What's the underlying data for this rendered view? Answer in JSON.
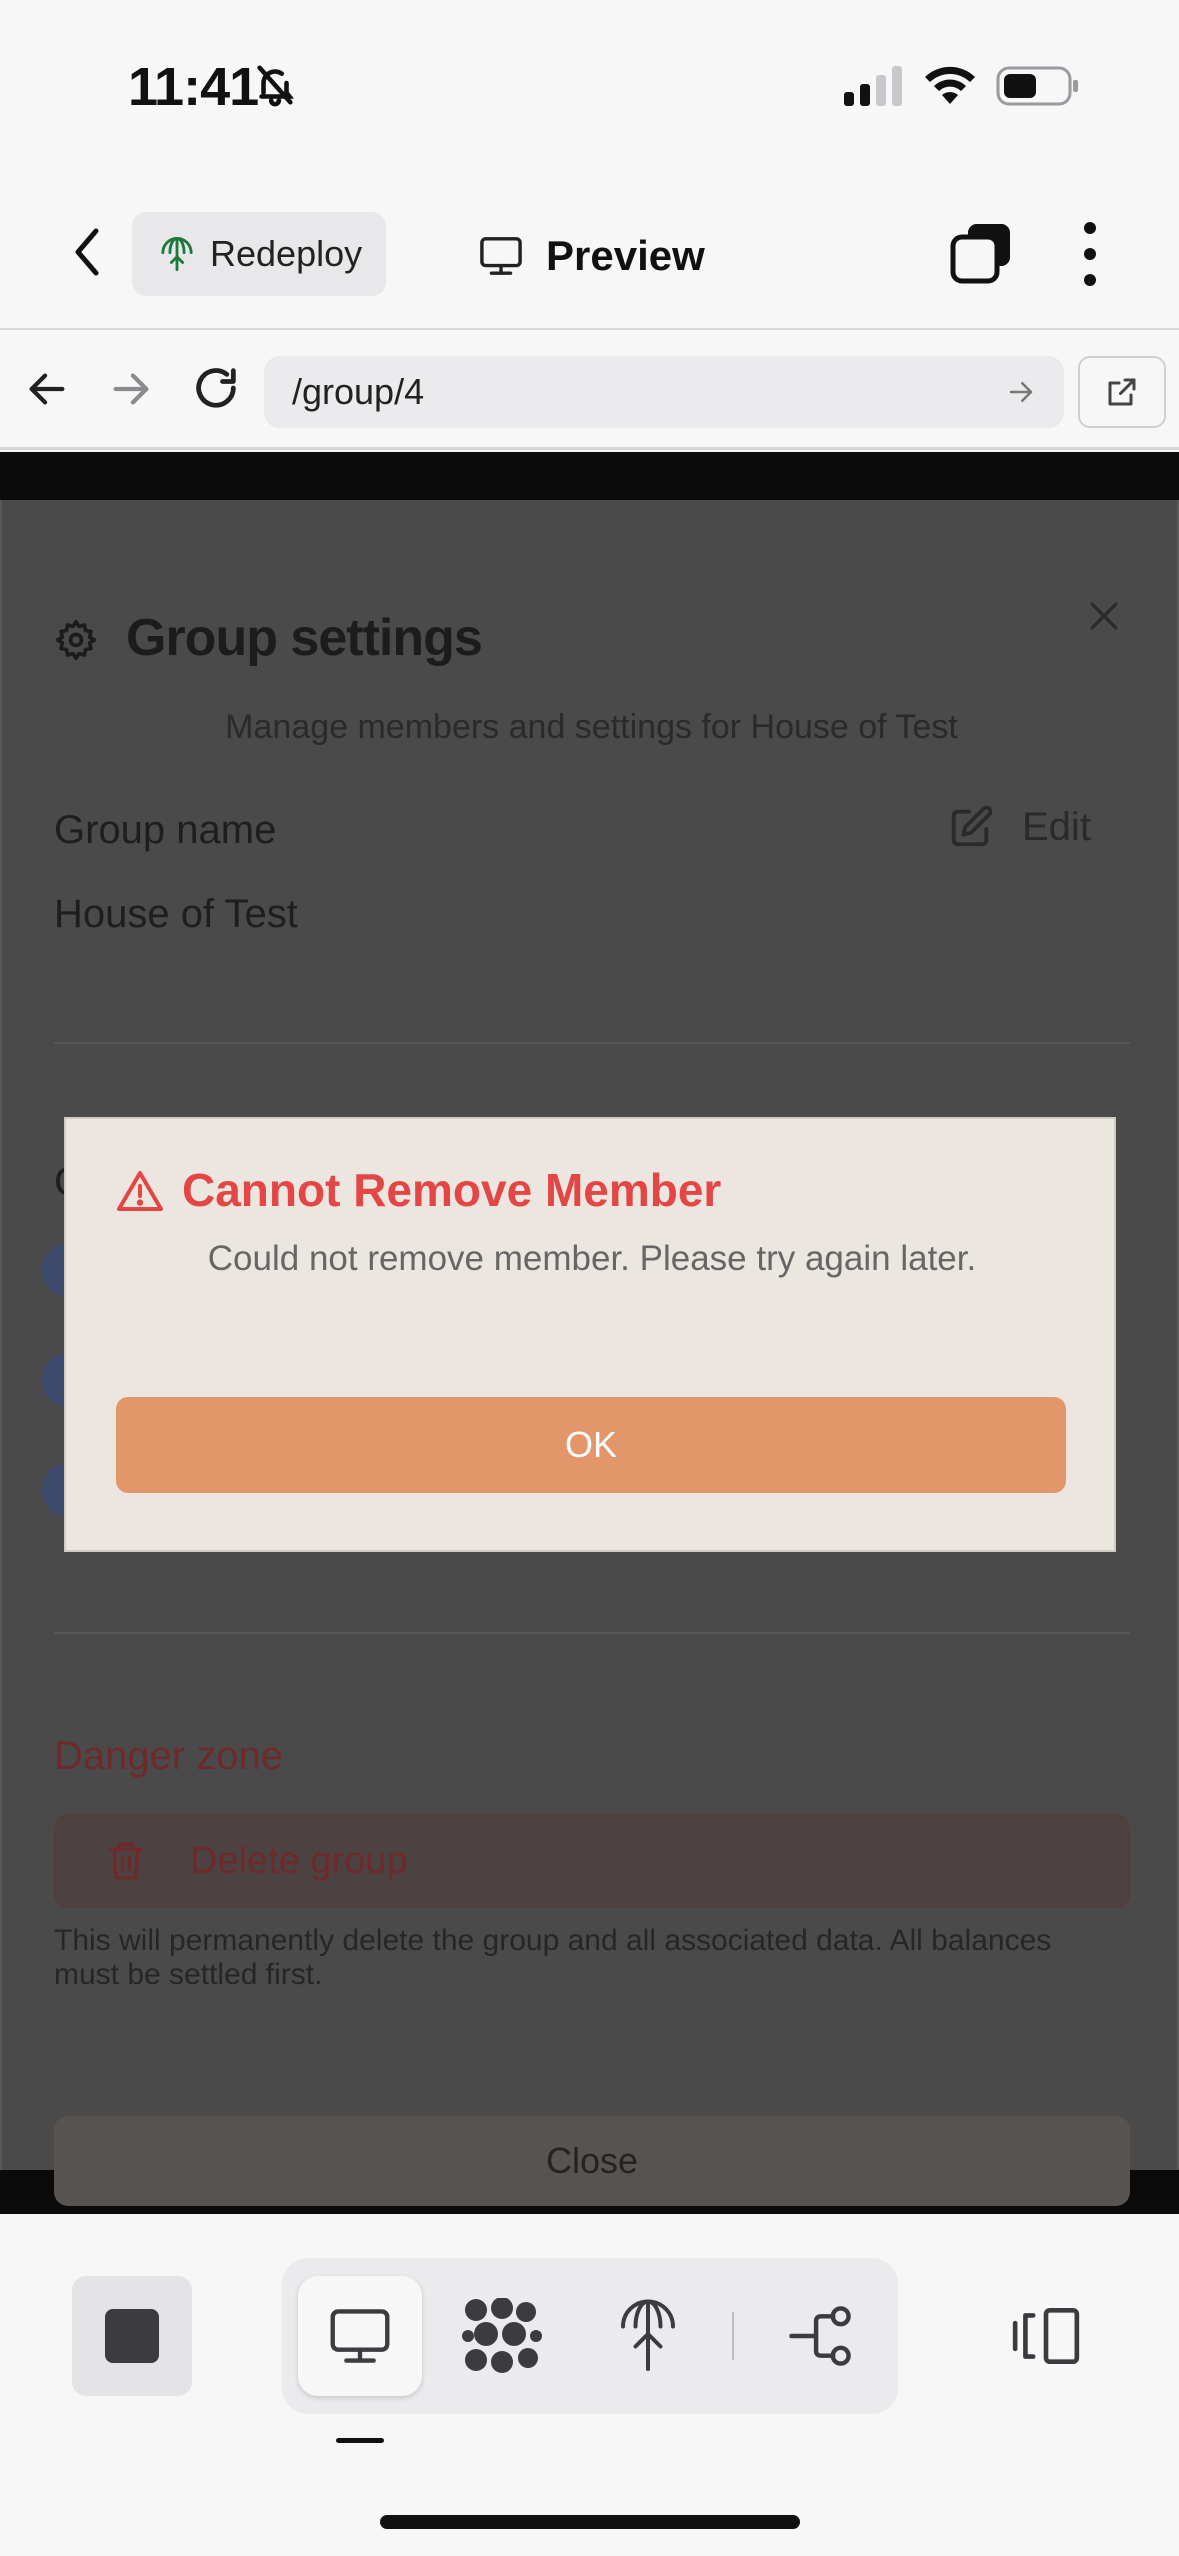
{
  "status_bar": {
    "time": "11:41",
    "silent_icon": "bell-slash-icon",
    "signal_icon": "cellular-signal-icon",
    "wifi_icon": "wifi-icon",
    "battery_icon": "battery-icon"
  },
  "header": {
    "redeploy_label": "Redeploy",
    "preview_label": "Preview"
  },
  "browser": {
    "url": "/group/4"
  },
  "group_settings": {
    "title": "Group settings",
    "subtitle": "Manage members and settings for House of Test",
    "group_name_label": "Group name",
    "edit_label": "Edit",
    "group_name_value": "House of Test",
    "members_label_peek": "C",
    "danger_zone_label": "Danger zone",
    "delete_group_label": "Delete group",
    "delete_note": "This will permanently delete the group and all associated data. All balances must be settled first.",
    "close_label": "Close"
  },
  "alert": {
    "title": "Cannot Remove Member",
    "message": "Could not remove member. Please try again later.",
    "ok_label": "OK",
    "title_color": "#e44545",
    "ok_color": "#e4966b"
  },
  "toolbar": {
    "items": [
      "stop-icon",
      "desktop-icon",
      "mesh-icon",
      "deploy-icon",
      "flow-icon",
      "panel-toggle-icon"
    ],
    "active": "desktop-icon"
  }
}
